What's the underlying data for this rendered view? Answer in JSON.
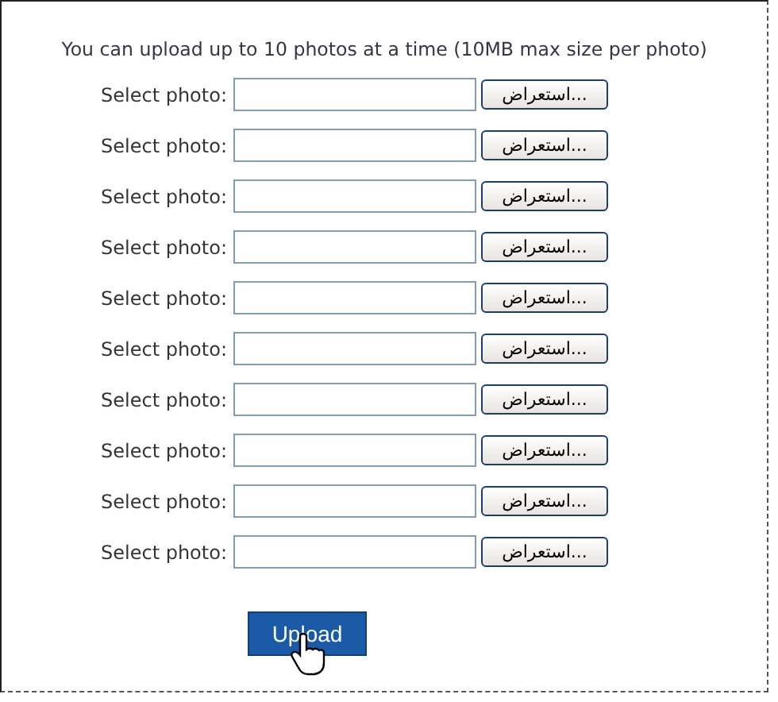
{
  "intro": "You can upload up to 10 photos at a time (10MB max size per photo)",
  "rows": [
    {
      "label": "Select photo:",
      "browse": "استعراض..."
    },
    {
      "label": "Select photo:",
      "browse": "استعراض..."
    },
    {
      "label": "Select photo:",
      "browse": "استعراض..."
    },
    {
      "label": "Select photo:",
      "browse": "استعراض..."
    },
    {
      "label": "Select photo:",
      "browse": "استعراض..."
    },
    {
      "label": "Select photo:",
      "browse": "استعراض..."
    },
    {
      "label": "Select photo:",
      "browse": "استعراض..."
    },
    {
      "label": "Select photo:",
      "browse": "استعراض..."
    },
    {
      "label": "Select photo:",
      "browse": "استعراض..."
    },
    {
      "label": "Select photo:",
      "browse": "استعراض..."
    }
  ],
  "upload_button": "Upload"
}
